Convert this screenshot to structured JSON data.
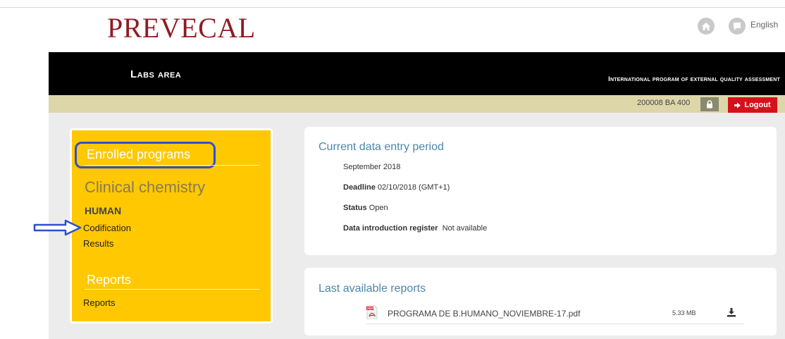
{
  "header": {
    "logo": "PREVECAL",
    "language": "English",
    "home_icon": "home-icon",
    "flag_icon": "flag-icon"
  },
  "banner": {
    "area_title": "Labs area",
    "program_title": "International program of external quality assessment"
  },
  "userbar": {
    "lab_code": "200008 BA 400",
    "lock_icon": "lock-icon",
    "logout_label": "Logout"
  },
  "sidebar": {
    "enrolled_heading": "Enrolled programs",
    "program_name": "Clinical chemistry",
    "subprogram": "HUMAN",
    "links": [
      "Codification",
      "Results"
    ],
    "reports_heading": "Reports",
    "reports_link": "Reports"
  },
  "current_period": {
    "title": "Current data entry period",
    "period": "September 2018",
    "deadline_label": "Deadline",
    "deadline_value": "02/10/2018 (GMT+1)",
    "status_label": "Status",
    "status_value": "Open",
    "register_label": "Data introduction register",
    "register_value": "Not available"
  },
  "reports": {
    "title": "Last available reports",
    "files": [
      {
        "name": "PROGRAMA DE B.HUMANO_NOVIEMBRE-17.pdf",
        "size": "5.33 MB"
      }
    ]
  },
  "colors": {
    "brand": "#8e1c23",
    "panel_yellow": "#ffc800",
    "title_blue": "#4c87a9",
    "logout_red": "#d5121b",
    "annotation_blue": "#2f4fce"
  }
}
